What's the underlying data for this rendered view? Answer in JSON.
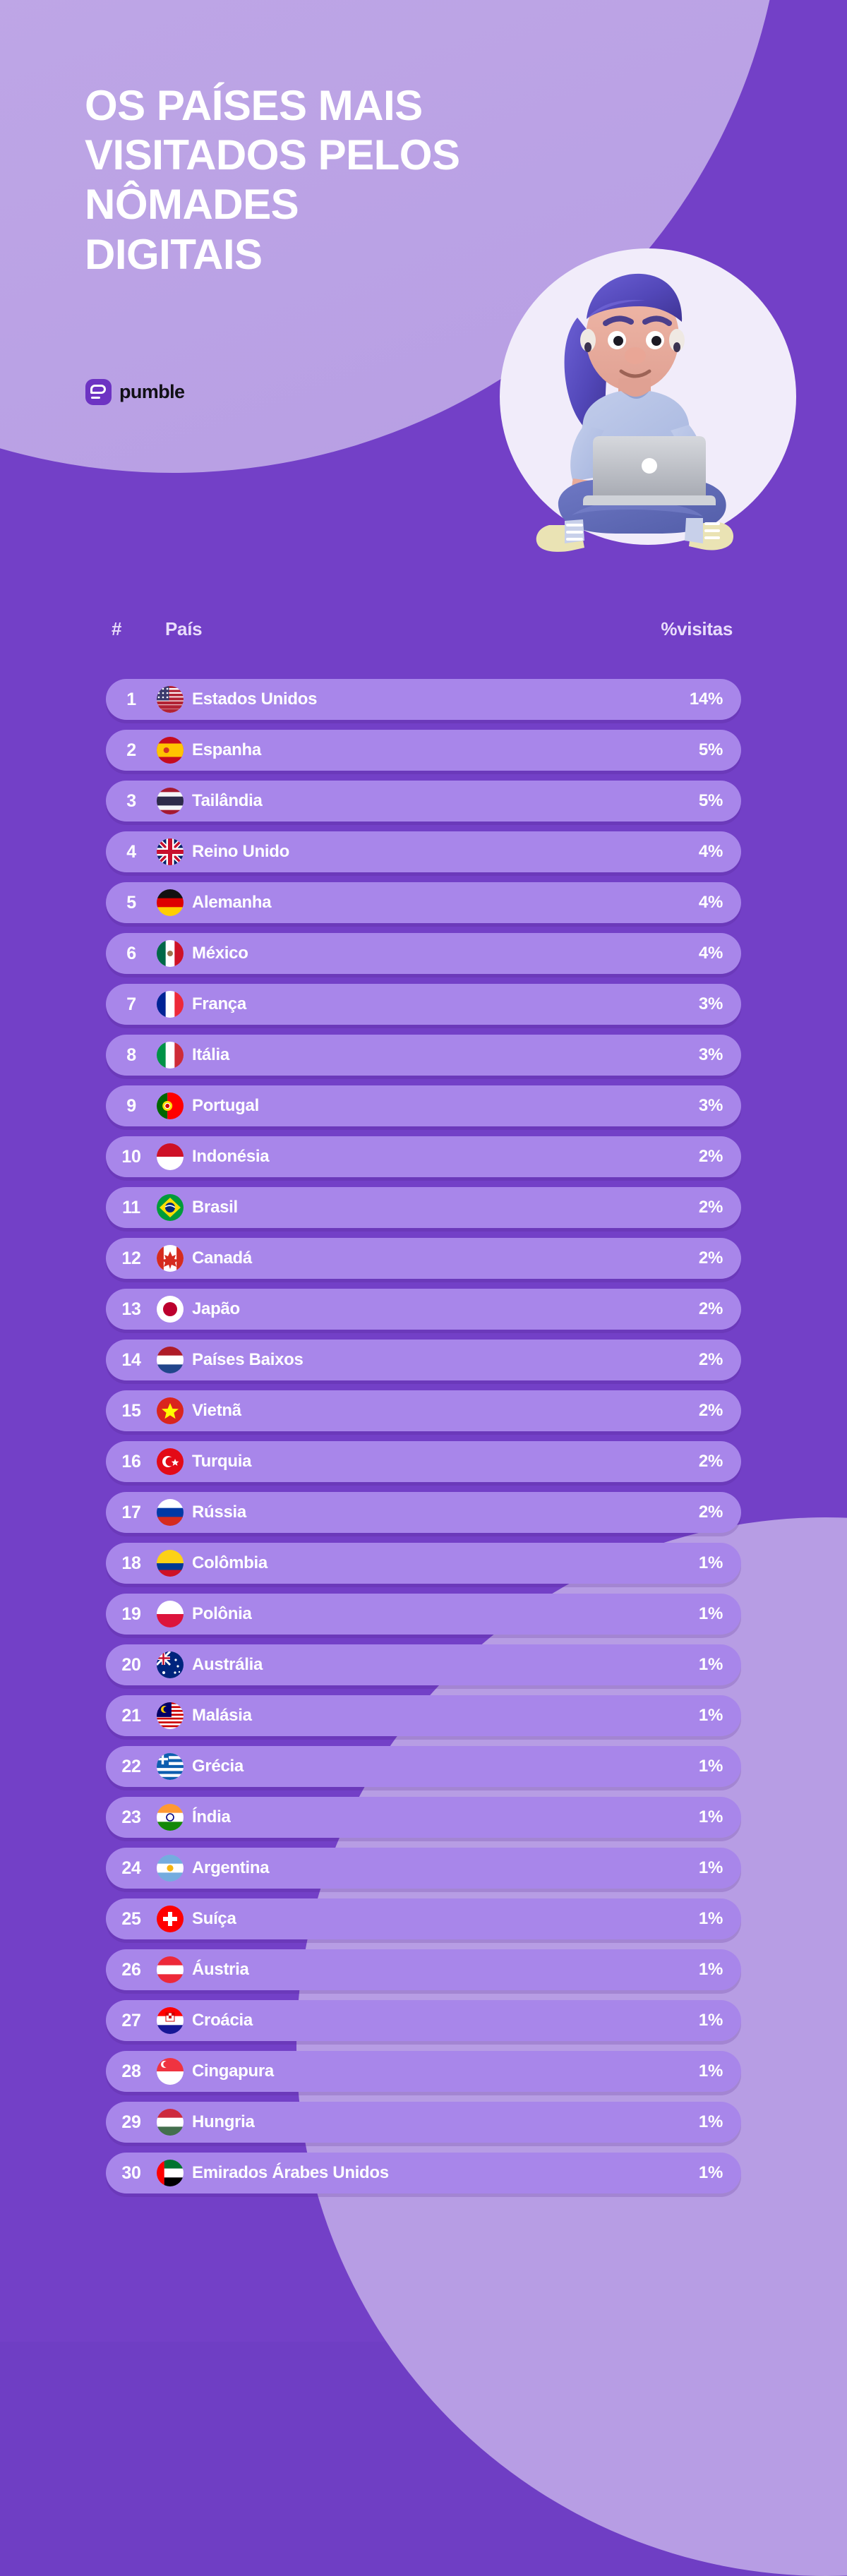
{
  "header": {
    "title_lines": [
      "OS PAÍSES MAIS",
      "VISITADOS PELOS",
      "NÔMADES",
      "DIGITAIS"
    ],
    "brand": "pumble"
  },
  "table": {
    "columns": {
      "rank": "#",
      "country": "País",
      "percent": "%visitas"
    }
  },
  "colors": {
    "background": "#7340c7",
    "blob_light": "#bfa7e6",
    "row": "#a886ea",
    "text": "#ffffff",
    "brand_purple": "#6d33c3"
  },
  "chart_data": {
    "type": "table",
    "title": "OS PAÍSES MAIS VISITADOS PELOS NÔMADES DIGITAIS",
    "columns": [
      "#",
      "País",
      "%visitas"
    ],
    "categories": [
      "Estados Unidos",
      "Espanha",
      "Tailândia",
      "Reino Unido",
      "Alemanha",
      "México",
      "França",
      "Itália",
      "Portugal",
      "Indonésia",
      "Brasil",
      "Canadá",
      "Japão",
      "Países Baixos",
      "Vietnã",
      "Turquia",
      "Rússia",
      "Colômbia",
      "Polônia",
      "Austrália",
      "Malásia",
      "Grécia",
      "Índia",
      "Argentina",
      "Suíça",
      "Áustria",
      "Croácia",
      "Cingapura",
      "Hungria",
      "Emirados Árabes Unidos"
    ],
    "values": [
      14,
      5,
      5,
      4,
      4,
      4,
      3,
      3,
      3,
      2,
      2,
      2,
      2,
      2,
      2,
      2,
      2,
      1,
      1,
      1,
      1,
      1,
      1,
      1,
      1,
      1,
      1,
      1,
      1,
      1
    ],
    "ylabel": "%visitas",
    "xlabel": "País"
  },
  "rows": [
    {
      "rank": "1",
      "country": "Estados Unidos",
      "pct": "14%",
      "flag": "us"
    },
    {
      "rank": "2",
      "country": "Espanha",
      "pct": "5%",
      "flag": "es"
    },
    {
      "rank": "3",
      "country": "Tailândia",
      "pct": "5%",
      "flag": "th"
    },
    {
      "rank": "4",
      "country": "Reino Unido",
      "pct": "4%",
      "flag": "gb"
    },
    {
      "rank": "5",
      "country": "Alemanha",
      "pct": "4%",
      "flag": "de"
    },
    {
      "rank": "6",
      "country": "México",
      "pct": "4%",
      "flag": "mx"
    },
    {
      "rank": "7",
      "country": "França",
      "pct": "3%",
      "flag": "fr"
    },
    {
      "rank": "8",
      "country": "Itália",
      "pct": "3%",
      "flag": "it"
    },
    {
      "rank": "9",
      "country": "Portugal",
      "pct": "3%",
      "flag": "pt"
    },
    {
      "rank": "10",
      "country": "Indonésia",
      "pct": "2%",
      "flag": "id"
    },
    {
      "rank": "11",
      "country": "Brasil",
      "pct": "2%",
      "flag": "br"
    },
    {
      "rank": "12",
      "country": "Canadá",
      "pct": "2%",
      "flag": "ca"
    },
    {
      "rank": "13",
      "country": "Japão",
      "pct": "2%",
      "flag": "jp"
    },
    {
      "rank": "14",
      "country": "Países Baixos",
      "pct": "2%",
      "flag": "nl"
    },
    {
      "rank": "15",
      "country": "Vietnã",
      "pct": "2%",
      "flag": "vn"
    },
    {
      "rank": "16",
      "country": "Turquia",
      "pct": "2%",
      "flag": "tr"
    },
    {
      "rank": "17",
      "country": "Rússia",
      "pct": "2%",
      "flag": "ru"
    },
    {
      "rank": "18",
      "country": "Colômbia",
      "pct": "1%",
      "flag": "co"
    },
    {
      "rank": "19",
      "country": "Polônia",
      "pct": "1%",
      "flag": "pl"
    },
    {
      "rank": "20",
      "country": "Austrália",
      "pct": "1%",
      "flag": "au"
    },
    {
      "rank": "21",
      "country": "Malásia",
      "pct": "1%",
      "flag": "my"
    },
    {
      "rank": "22",
      "country": "Grécia",
      "pct": "1%",
      "flag": "gr"
    },
    {
      "rank": "23",
      "country": "Índia",
      "pct": "1%",
      "flag": "in"
    },
    {
      "rank": "24",
      "country": "Argentina",
      "pct": "1%",
      "flag": "ar"
    },
    {
      "rank": "25",
      "country": "Suíça",
      "pct": "1%",
      "flag": "ch"
    },
    {
      "rank": "26",
      "country": "Áustria",
      "pct": "1%",
      "flag": "at"
    },
    {
      "rank": "27",
      "country": "Croácia",
      "pct": "1%",
      "flag": "hr"
    },
    {
      "rank": "28",
      "country": "Cingapura",
      "pct": "1%",
      "flag": "sg"
    },
    {
      "rank": "29",
      "country": "Hungria",
      "pct": "1%",
      "flag": "hu"
    },
    {
      "rank": "30",
      "country": "Emirados Árabes Unidos",
      "pct": "1%",
      "flag": "ae"
    }
  ]
}
